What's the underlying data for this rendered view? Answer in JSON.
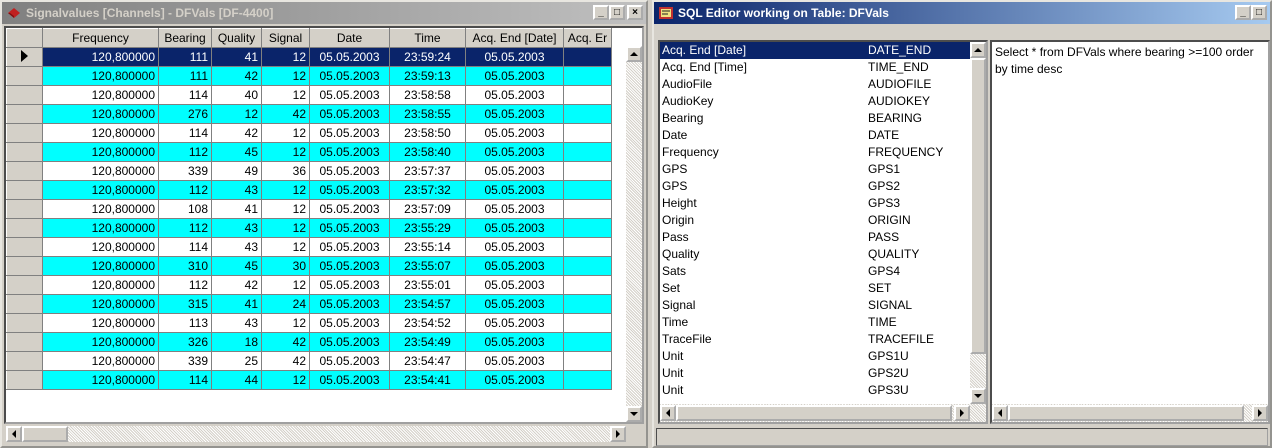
{
  "left_window": {
    "title": "Signalvalues  [Channels] - DFVals  [DF-4400]",
    "caption_buttons": {
      "minimize": "_",
      "maximize": "□",
      "close": "×"
    },
    "columns": [
      "Frequency",
      "Bearing",
      "Quality",
      "Signal",
      "Date",
      "Time",
      "Acq. End [Date]",
      "Acq. Er"
    ],
    "rows": [
      {
        "frequency": "120,800000",
        "bearing": "111",
        "quality": "41",
        "signal": "12",
        "date": "05.05.2003",
        "time": "23:59:24",
        "acq_end": "05.05.2003"
      },
      {
        "frequency": "120,800000",
        "bearing": "111",
        "quality": "42",
        "signal": "12",
        "date": "05.05.2003",
        "time": "23:59:13",
        "acq_end": "05.05.2003"
      },
      {
        "frequency": "120,800000",
        "bearing": "114",
        "quality": "40",
        "signal": "12",
        "date": "05.05.2003",
        "time": "23:58:58",
        "acq_end": "05.05.2003"
      },
      {
        "frequency": "120,800000",
        "bearing": "276",
        "quality": "12",
        "signal": "42",
        "date": "05.05.2003",
        "time": "23:58:55",
        "acq_end": "05.05.2003"
      },
      {
        "frequency": "120,800000",
        "bearing": "114",
        "quality": "42",
        "signal": "12",
        "date": "05.05.2003",
        "time": "23:58:50",
        "acq_end": "05.05.2003"
      },
      {
        "frequency": "120,800000",
        "bearing": "112",
        "quality": "45",
        "signal": "12",
        "date": "05.05.2003",
        "time": "23:58:40",
        "acq_end": "05.05.2003"
      },
      {
        "frequency": "120,800000",
        "bearing": "339",
        "quality": "49",
        "signal": "36",
        "date": "05.05.2003",
        "time": "23:57:37",
        "acq_end": "05.05.2003"
      },
      {
        "frequency": "120,800000",
        "bearing": "112",
        "quality": "43",
        "signal": "12",
        "date": "05.05.2003",
        "time": "23:57:32",
        "acq_end": "05.05.2003"
      },
      {
        "frequency": "120,800000",
        "bearing": "108",
        "quality": "41",
        "signal": "12",
        "date": "05.05.2003",
        "time": "23:57:09",
        "acq_end": "05.05.2003"
      },
      {
        "frequency": "120,800000",
        "bearing": "112",
        "quality": "43",
        "signal": "12",
        "date": "05.05.2003",
        "time": "23:55:29",
        "acq_end": "05.05.2003"
      },
      {
        "frequency": "120,800000",
        "bearing": "114",
        "quality": "43",
        "signal": "12",
        "date": "05.05.2003",
        "time": "23:55:14",
        "acq_end": "05.05.2003"
      },
      {
        "frequency": "120,800000",
        "bearing": "310",
        "quality": "45",
        "signal": "30",
        "date": "05.05.2003",
        "time": "23:55:07",
        "acq_end": "05.05.2003"
      },
      {
        "frequency": "120,800000",
        "bearing": "112",
        "quality": "42",
        "signal": "12",
        "date": "05.05.2003",
        "time": "23:55:01",
        "acq_end": "05.05.2003"
      },
      {
        "frequency": "120,800000",
        "bearing": "315",
        "quality": "41",
        "signal": "24",
        "date": "05.05.2003",
        "time": "23:54:57",
        "acq_end": "05.05.2003"
      },
      {
        "frequency": "120,800000",
        "bearing": "113",
        "quality": "43",
        "signal": "12",
        "date": "05.05.2003",
        "time": "23:54:52",
        "acq_end": "05.05.2003"
      },
      {
        "frequency": "120,800000",
        "bearing": "326",
        "quality": "18",
        "signal": "42",
        "date": "05.05.2003",
        "time": "23:54:49",
        "acq_end": "05.05.2003"
      },
      {
        "frequency": "120,800000",
        "bearing": "339",
        "quality": "25",
        "signal": "42",
        "date": "05.05.2003",
        "time": "23:54:47",
        "acq_end": "05.05.2003"
      },
      {
        "frequency": "120,800000",
        "bearing": "114",
        "quality": "44",
        "signal": "12",
        "date": "05.05.2003",
        "time": "23:54:41",
        "acq_end": "05.05.2003"
      }
    ]
  },
  "right_window": {
    "title": "SQL Editor working on Table: DFVals",
    "caption_buttons": {
      "minimize": "_",
      "maximize": "□"
    },
    "fields": [
      {
        "label": "Acq. End [Date]",
        "column": "DATE_END"
      },
      {
        "label": "Acq. End [Time]",
        "column": "TIME_END"
      },
      {
        "label": "AudioFile",
        "column": "AUDIOFILE"
      },
      {
        "label": "AudioKey",
        "column": "AUDIOKEY"
      },
      {
        "label": "Bearing",
        "column": "BEARING"
      },
      {
        "label": "Date",
        "column": "DATE"
      },
      {
        "label": "Frequency",
        "column": "FREQUENCY"
      },
      {
        "label": "GPS",
        "column": "GPS1"
      },
      {
        "label": "GPS",
        "column": "GPS2"
      },
      {
        "label": "Height",
        "column": "GPS3"
      },
      {
        "label": "Origin",
        "column": "ORIGIN"
      },
      {
        "label": "Pass",
        "column": "PASS"
      },
      {
        "label": "Quality",
        "column": "QUALITY"
      },
      {
        "label": "Sats",
        "column": "GPS4"
      },
      {
        "label": "Set",
        "column": "SET"
      },
      {
        "label": "Signal",
        "column": "SIGNAL"
      },
      {
        "label": "Time",
        "column": "TIME"
      },
      {
        "label": "TraceFile",
        "column": "TRACEFILE"
      },
      {
        "label": "Unit",
        "column": "GPS1U"
      },
      {
        "label": "Unit",
        "column": "GPS2U"
      },
      {
        "label": "Unit",
        "column": "GPS3U"
      }
    ],
    "sql_text": "Select * from DFVals where bearing >=100 order by time desc"
  },
  "colors": {
    "alt_row": "#00ffff",
    "selection": "#0a246a",
    "face": "#d4d0c8"
  }
}
